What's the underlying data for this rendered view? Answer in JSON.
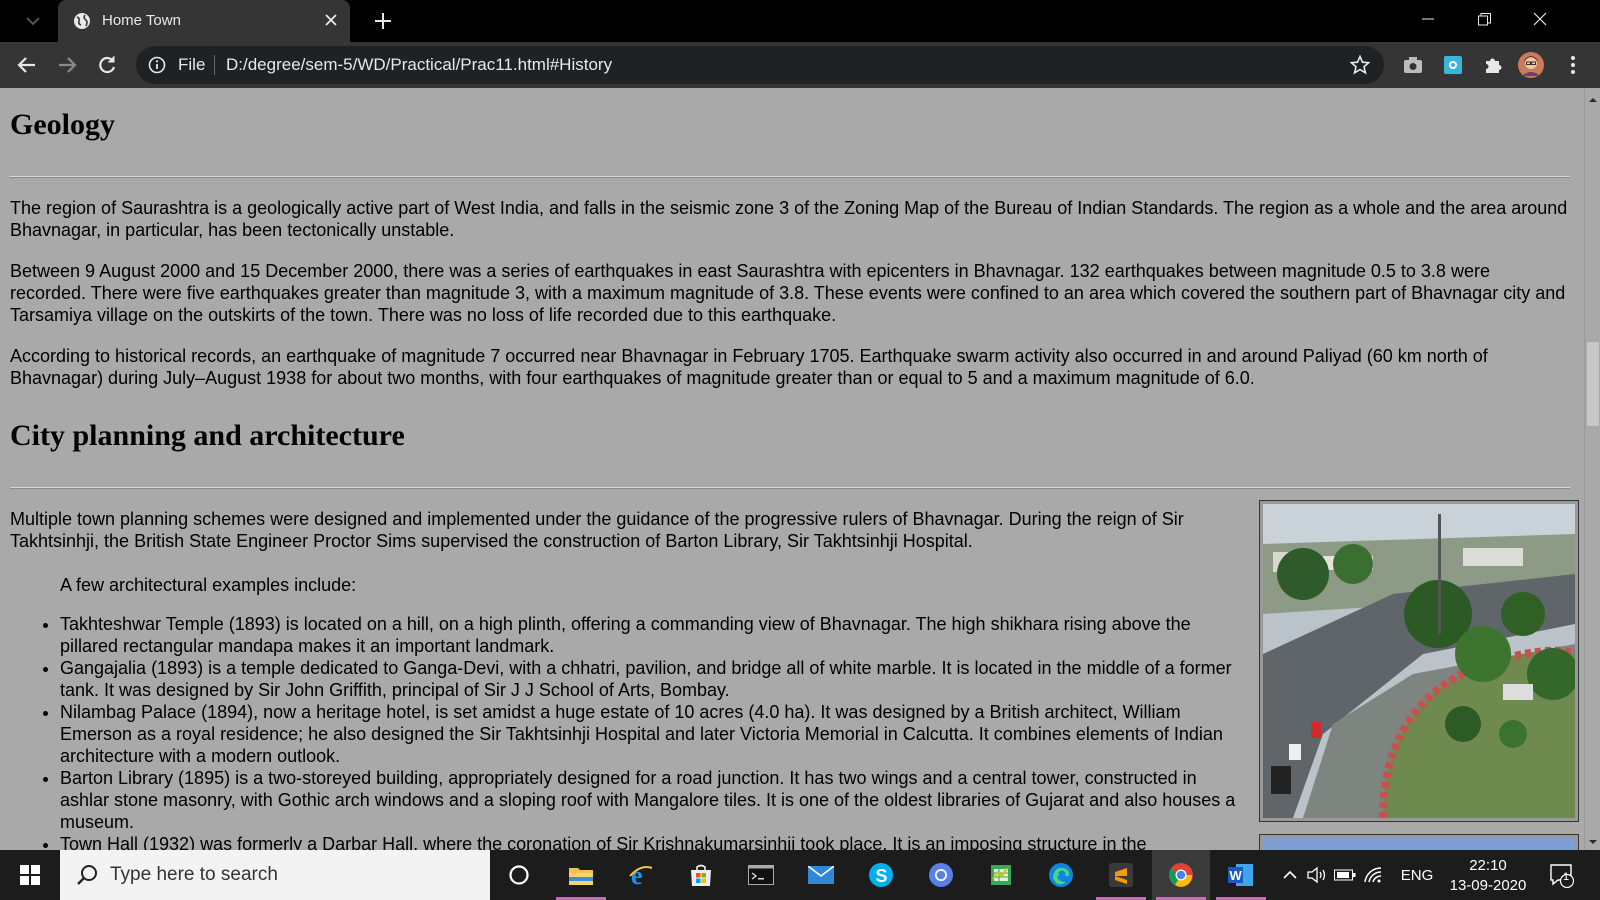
{
  "browser": {
    "tab_title": "Home Town",
    "address_scheme": "File",
    "address_url": "D:/degree/sem-5/WD/Practical/Prac11.html#History"
  },
  "page": {
    "geology": {
      "heading": "Geology",
      "paragraphs": [
        "The region of Saurashtra is a geologically active part of West India, and falls in the seismic zone 3 of the Zoning Map of the Bureau of Indian Standards. The region as a whole and the area around Bhavnagar, in particular, has been tectonically unstable.",
        "Between 9 August 2000 and 15 December 2000, there was a series of earthquakes in east Saurashtra with epicenters in Bhavnagar. 132 earthquakes between magnitude 0.5 to 3.8 were recorded. There were five earthquakes greater than magnitude 3, with a maximum magnitude of 3.8. These events were confined to an area which covered the southern part of Bhavnagar city and Tarsamiya village on the outskirts of the town. There was no loss of life recorded due to this earthquake.",
        "According to historical records, an earthquake of magnitude 7 occurred near Bhavnagar in February 1705. Earthquake swarm activity also occurred in and around Paliyad (60 km north of Bhavnagar) during July–August 1938 for about two months, with four earthquakes of magnitude greater than or equal to 5 and a maximum magnitude of 6.0."
      ]
    },
    "city_planning": {
      "heading": "City planning and architecture",
      "paragraph": "Multiple town planning schemes were designed and implemented under the guidance of the progressive rulers of Bhavnagar. During the reign of Sir Takhtsinhji, the British State Engineer Proctor Sims supervised the construction of Barton Library, Sir Takhtsinhji Hospital.",
      "intro": "A few architectural examples include:",
      "examples": [
        "Takhteshwar Temple (1893) is located on a hill, on a high plinth, offering a commanding view of Bhavnagar. The high shikhara rising above the pillared rectangular mandapa makes it an important landmark.",
        "Gangajalia (1893) is a temple dedicated to Ganga-Devi, with a chhatri, pavilion, and bridge all of white marble. It is located in the middle of a former tank. It was designed by Sir John Griffith, principal of Sir J J School of Arts, Bombay.",
        "Nilambag Palace (1894), now a heritage hotel, is set amidst a huge estate of 10 acres (4.0 ha). It was designed by a British architect, William Emerson as a royal residence; he also designed the Sir Takhtsinhji Hospital and later Victoria Memorial in Calcutta. It combines elements of Indian architecture with a modern outlook.",
        "Barton Library (1895) is a two-storeyed building, appropriately designed for a road junction. It has two wings and a central tower, constructed in ashlar stone masonry, with Gothic arch windows and a sloping roof with Mangalore tiles. It is one of the oldest libraries of Gujarat and also houses a museum.",
        "Town Hall (1932) was formerly a Darbar Hall, where the coronation of Sir Krishnakumarsinhji took place. It is an imposing structure in the"
      ]
    }
  },
  "taskbar": {
    "search_placeholder": "Type here to search",
    "language": "ENG",
    "time": "22:10",
    "date": "13-09-2020",
    "notification_count": "1"
  }
}
